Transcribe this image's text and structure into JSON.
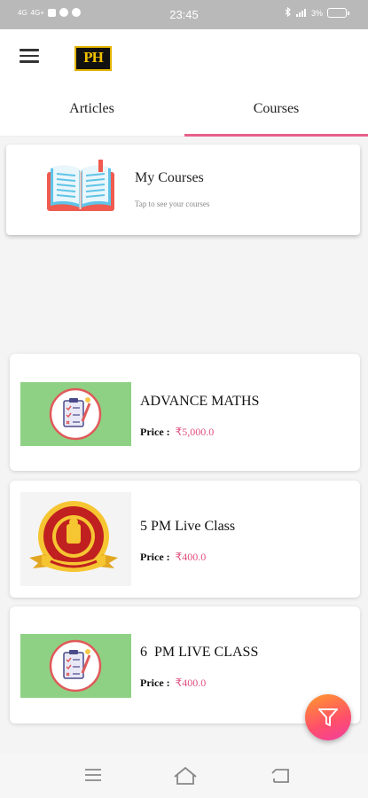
{
  "status_bar": {
    "time": "23:45",
    "left_network_1": "4G",
    "left_network_2": "4G+",
    "battery": "3%",
    "icons": [
      "sim-signal-icon",
      "notification-icon",
      "app-icon",
      "circle-icon",
      "bluetooth-icon",
      "signal-icon",
      "battery-icon"
    ]
  },
  "app_bar": {
    "logo_text": "PH",
    "menu_icon": "hamburger-menu-icon"
  },
  "tabs": [
    {
      "label": "Articles",
      "active": false
    },
    {
      "label": "Courses",
      "active": true
    }
  ],
  "my_courses": {
    "title": "My Courses",
    "subtitle": "Tap to see your courses",
    "icon": "open-book-icon"
  },
  "courses": [
    {
      "title": "ADVANCE MATHS",
      "price_label": "Price :",
      "price": "₹5,000.0",
      "thumbnail": "checklist-icon"
    },
    {
      "title": "5 PM Live Class",
      "price_label": "Price :",
      "price": "₹400.0",
      "thumbnail": "emblem-seal"
    },
    {
      "title": "6  PM LIVE CLASS",
      "price_label": "Price :",
      "price": "₹400.0",
      "thumbnail": "checklist-icon"
    }
  ],
  "fab": {
    "icon": "filter-icon"
  },
  "nav_bar": {
    "icons": [
      "menu-nav-icon",
      "home-nav-icon",
      "back-nav-icon"
    ]
  },
  "colors": {
    "accent": "#e8608a",
    "price": "#e0507e",
    "thumb_bg": "#8fd184"
  }
}
